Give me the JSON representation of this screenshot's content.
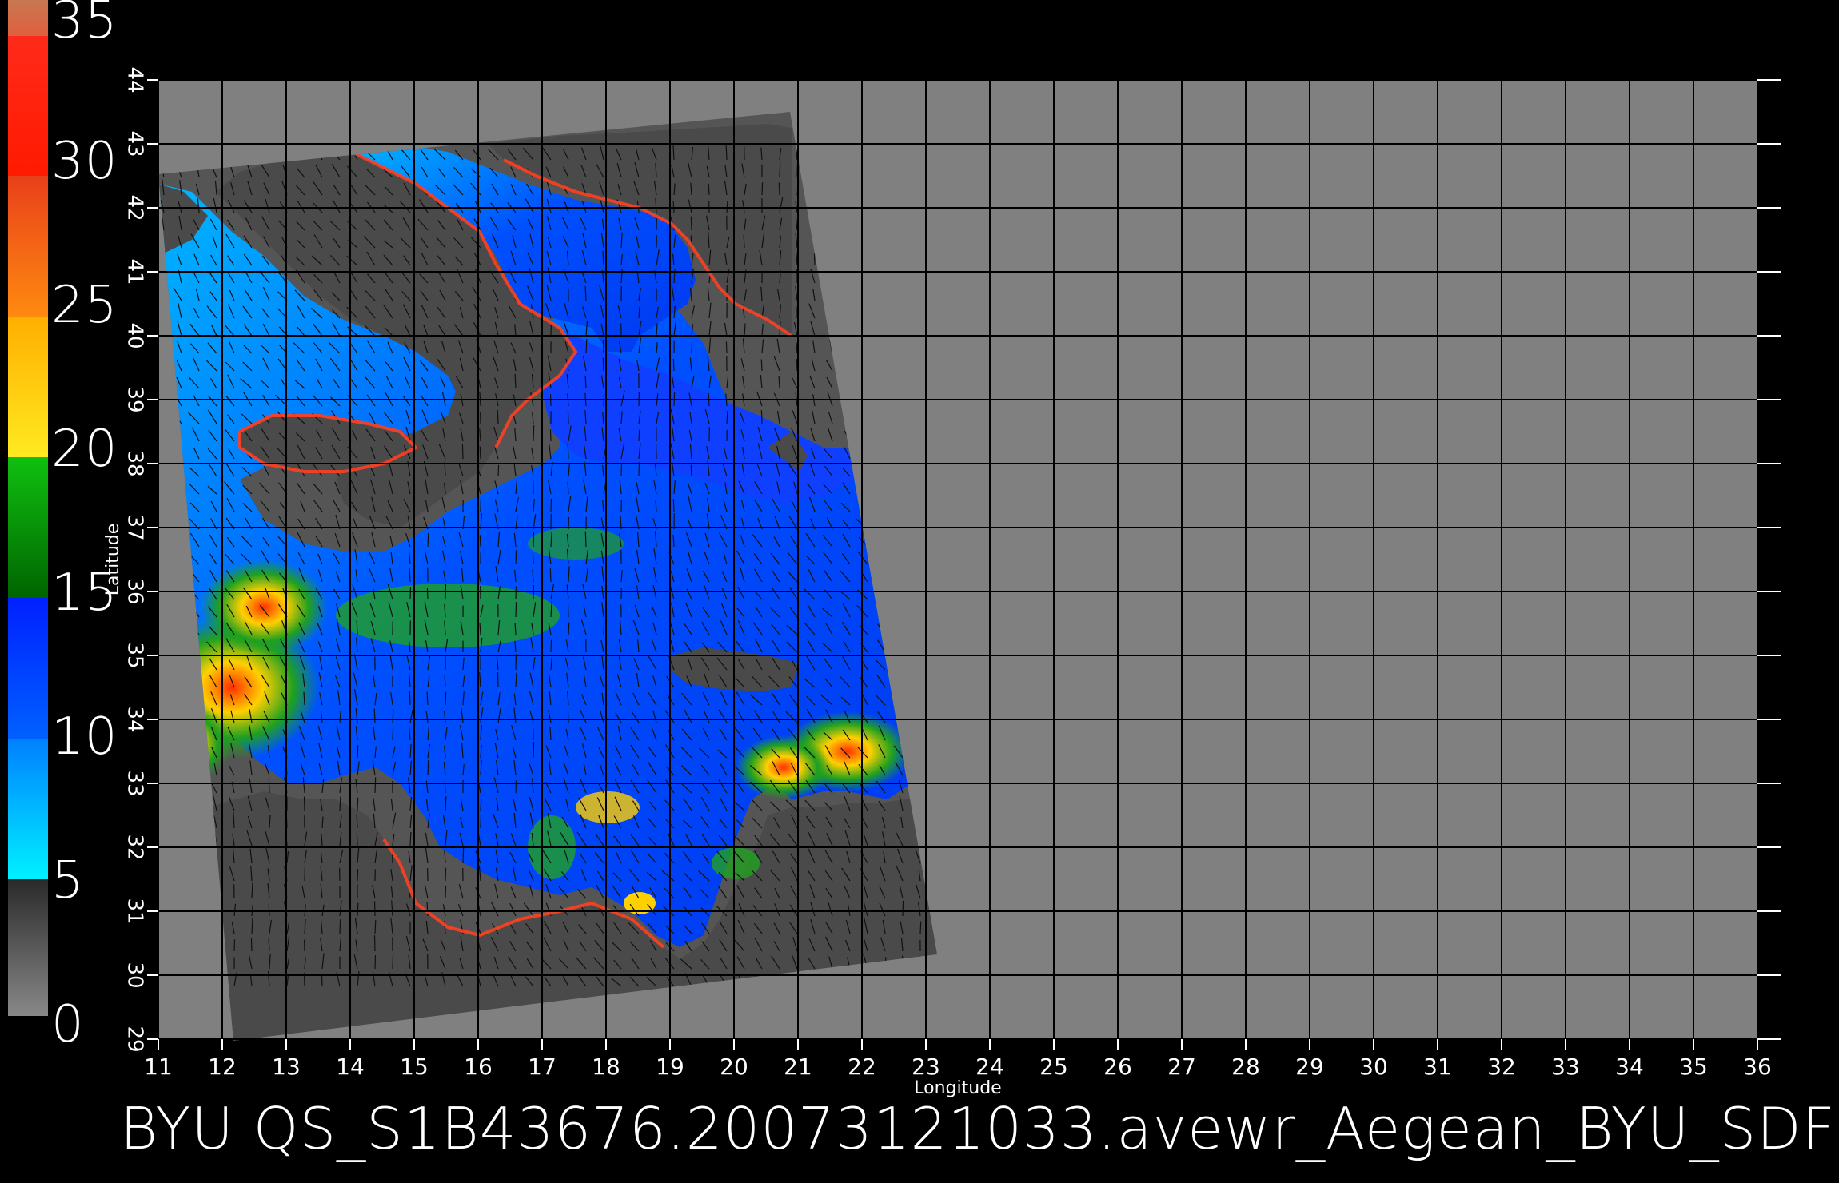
{
  "colorbar": {
    "ticks": [
      "35",
      "30",
      "25",
      "20",
      "15",
      "10",
      "5",
      "0"
    ],
    "colors": [
      "#c87850",
      "#ff2a1a",
      "#e8501a",
      "#ff9a00",
      "#ffe800",
      "#00b000",
      "#0030ff",
      "#00a8ff",
      "#00e6ff",
      "#404040",
      "#808080"
    ]
  },
  "map": {
    "x_axis": {
      "title": "Longitude",
      "ticks": [
        "11",
        "12",
        "13",
        "14",
        "15",
        "16",
        "17",
        "18",
        "19",
        "20",
        "21",
        "22",
        "23",
        "24",
        "25",
        "26",
        "27",
        "28",
        "29",
        "30",
        "31",
        "32",
        "33",
        "34",
        "35",
        "36"
      ]
    },
    "y_axis": {
      "title": "Latitude",
      "ticks": [
        "29",
        "30",
        "31",
        "32",
        "33",
        "34",
        "35",
        "36",
        "37",
        "38",
        "39",
        "40",
        "41",
        "42",
        "43",
        "44"
      ]
    },
    "colors": {
      "background": "#000000",
      "no_data": "#808080",
      "swath": "#555555",
      "land": "#4a4a4a",
      "grid": "#000000",
      "sea_low": "#0055ff",
      "sea_mid": "#00a0ff",
      "sea_high": "#00d0ff",
      "wind_green": "#20a020",
      "wind_yellow": "#ffd000",
      "wind_red": "#ff3000"
    }
  },
  "footer": {
    "text": "BYU  QS_S1B43676.20073121033.avewr_Aegean_BYU_SDF"
  }
}
